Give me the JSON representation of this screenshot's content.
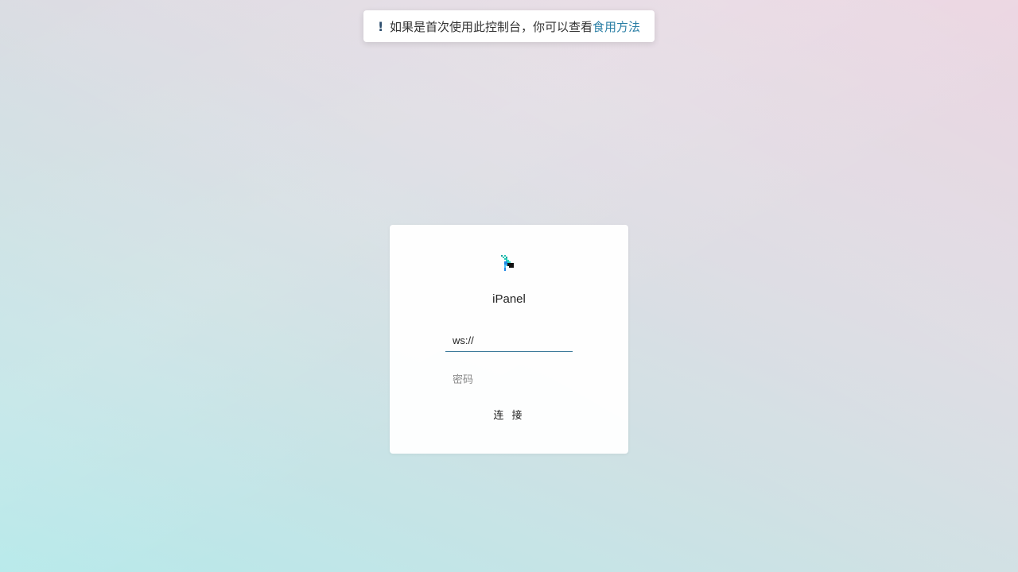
{
  "notice": {
    "icon": "exclamation-icon",
    "icon_glyph": "!",
    "text": "如果是首次使用此控制台，你可以查看",
    "link_label": "食用方法",
    "link_color": "#2b7fa5"
  },
  "login": {
    "logo_icon": "pixel-logo-icon",
    "app_name": "iPanel",
    "url_field": {
      "value": "ws://",
      "placeholder": ""
    },
    "password_field": {
      "value": "",
      "placeholder": "密码"
    },
    "connect_label": "连 接"
  },
  "colors": {
    "accent": "#3d7a9a",
    "gradient_start": "#b6e9ea",
    "gradient_end": "#ecd6e2"
  }
}
